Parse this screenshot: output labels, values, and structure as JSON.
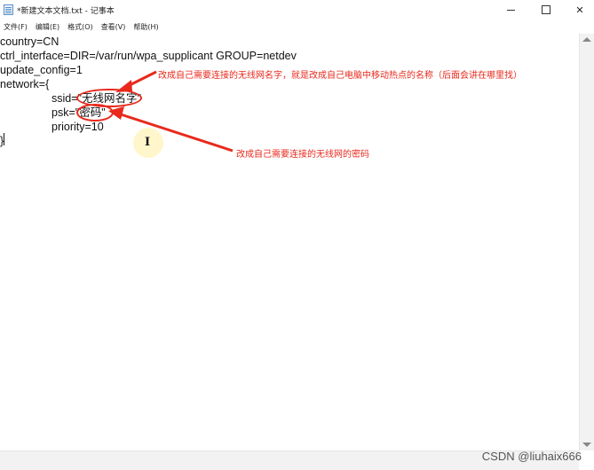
{
  "window": {
    "title": "*新建文本文档.txt - 记事本",
    "minimize": "—",
    "maximize": "□",
    "close": "✕"
  },
  "menu": [
    "文件(F)",
    "编辑(E)",
    "格式(O)",
    "查看(V)",
    "帮助(H)"
  ],
  "editor": {
    "lines": [
      "country=CN",
      "ctrl_interface=DIR=/var/run/wpa_supplicant GROUP=netdev",
      "update_config=1",
      "network={",
      "ssid=\"无线网名字\"",
      "psk=\"密码\"",
      "priority=10",
      "}"
    ]
  },
  "annotations": {
    "ssid_note": "改成自己需要连接的无线网名字，就是改成自己电脑中移动热点的名称（后面会讲在哪里找）",
    "psk_note": "改成自己需要连接的无线网的密码",
    "color": "#e8291c"
  },
  "watermark": "CSDN @liuhaix666",
  "icons": {
    "app": "notepad-icon",
    "cursor": "ibeam-cursor-icon"
  }
}
